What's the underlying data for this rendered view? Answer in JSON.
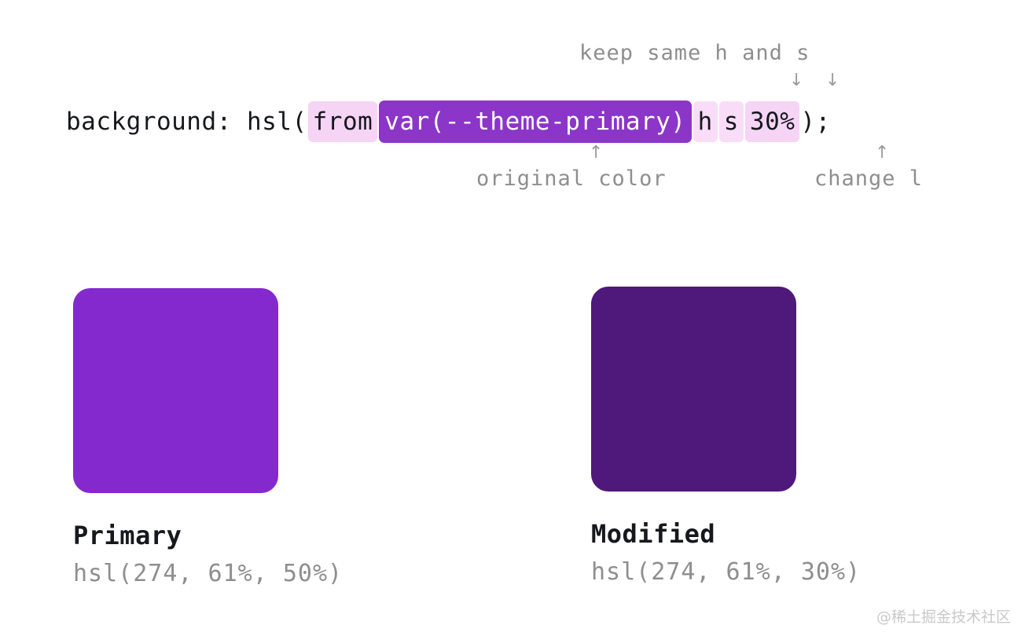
{
  "annotations": {
    "top_note": "keep same h and s",
    "arrow_down_h": "↓",
    "arrow_down_s": "↓",
    "arrow_up_original": "↑",
    "arrow_up_change": "↑",
    "original_color_note": "original color",
    "change_l_note": "change l"
  },
  "code": {
    "prefix": "background: hsl(",
    "from_keyword": "from",
    "color_reference": "var(--theme-primary)",
    "hue_channel": "h",
    "saturation_channel": "s",
    "lightness_value": "30%",
    "suffix": ");"
  },
  "swatches": [
    {
      "name": "Primary",
      "value": "hsl(274, 61%, 50%)",
      "color": "#8429ce"
    },
    {
      "name": "Modified",
      "value": "hsl(274, 61%, 30%)",
      "color": "#4f187b"
    }
  ],
  "colors": {
    "chip_pink": "#f6d4f6",
    "chip_pink_light": "#f9ddf8",
    "chip_purple": "#8c35c9",
    "text_dark": "#16181d",
    "text_gray": "#8e8e8e",
    "background": "#ffffff"
  },
  "watermark": "@稀土掘金技术社区"
}
